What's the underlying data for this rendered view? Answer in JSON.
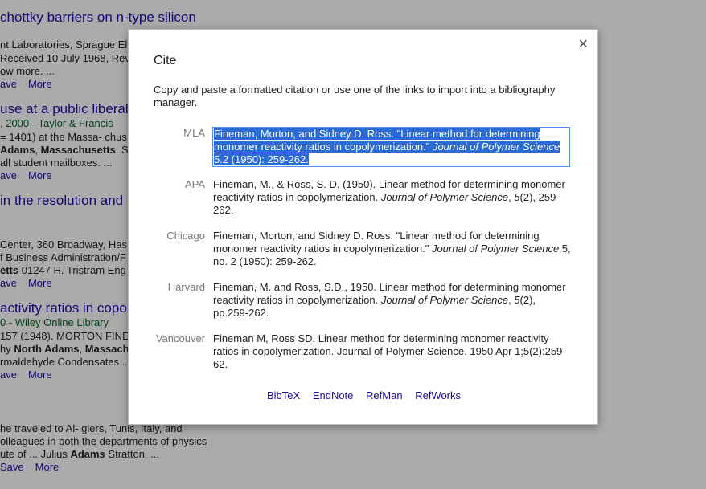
{
  "background": {
    "results": [
      {
        "title": "chottky barriers on n-type silicon",
        "lines": [
          "nt Laboratories, Sprague Ele",
          "Received 10 July 1968, Rev",
          "ow more. ..."
        ],
        "save": "ave",
        "more": "More"
      },
      {
        "title": "use at a public liberal",
        "green": ", 2000 - Taylor & Francis",
        "lines": [
          "= 1401) at the Massa- chus",
          "Adams, Massachusetts. S",
          "all student mailboxes. ..."
        ],
        "save": "ave",
        "more": "More"
      },
      {
        "title": "in the resolution and",
        "lines": [
          "Center, 360 Broadway, Has",
          "f Business Administration/F",
          "etts 01247 H. Tristram Eng"
        ],
        "save": "ave",
        "more": "More"
      },
      {
        "title": "activity ratios in copoly",
        "green": "0 - Wiley Online Library",
        "lines": [
          "157 (1948). MORTON FINE",
          "hy North Adams, Massach",
          "rmaldehyde Condensates ..."
        ],
        "save": "ave",
        "more": "More"
      },
      {
        "lines": [
          "he traveled to Al- giers, Tunis, Italy, and",
          "olleagues in both the departments of physics",
          "ute of ... Julius Adams Stratton. ..."
        ],
        "save": "Save",
        "more": "More"
      }
    ]
  },
  "dialog": {
    "title": "Cite",
    "close_glyph": "×",
    "intro": "Copy and paste a formatted citation or use one of the links to import into a bibliography manager.",
    "citations": [
      {
        "style": "MLA",
        "pre": "Fineman, Morton, and Sidney D. Ross. \"Linear method for determining monomer reactivity ratios in copolymerization.\" ",
        "journal": "Journal of Polymer Science",
        "post": " 5.2 (1950): 259-262."
      },
      {
        "style": "APA",
        "pre": "Fineman, M., & Ross, S. D. (1950). Linear method for determining monomer reactivity ratios in copolymerization. ",
        "journal": "Journal of Polymer Science",
        "post": ", ",
        "vol": "5",
        "post2": "(2), 259-262."
      },
      {
        "style": "Chicago",
        "pre": "Fineman, Morton, and Sidney D. Ross. \"Linear method for determining monomer reactivity ratios in copolymerization.\" ",
        "journal": "Journal of Polymer Science",
        "post": " 5, no. 2 (1950): 259-262."
      },
      {
        "style": "Harvard",
        "pre": "Fineman, M. and Ross, S.D., 1950. Linear method for determining monomer reactivity ratios in copolymerization. ",
        "journal": "Journal of Polymer Science",
        "post": ", ",
        "vol": "5",
        "post2": "(2), pp.259-262."
      },
      {
        "style": "Vancouver",
        "pre": "Fineman M, Ross SD. Linear method for determining monomer reactivity ratios in copolymerization. Journal of Polymer Science. 1950 Apr 1;5(2):259-62."
      }
    ],
    "export_links": [
      "BibTeX",
      "EndNote",
      "RefMan",
      "RefWorks"
    ]
  }
}
